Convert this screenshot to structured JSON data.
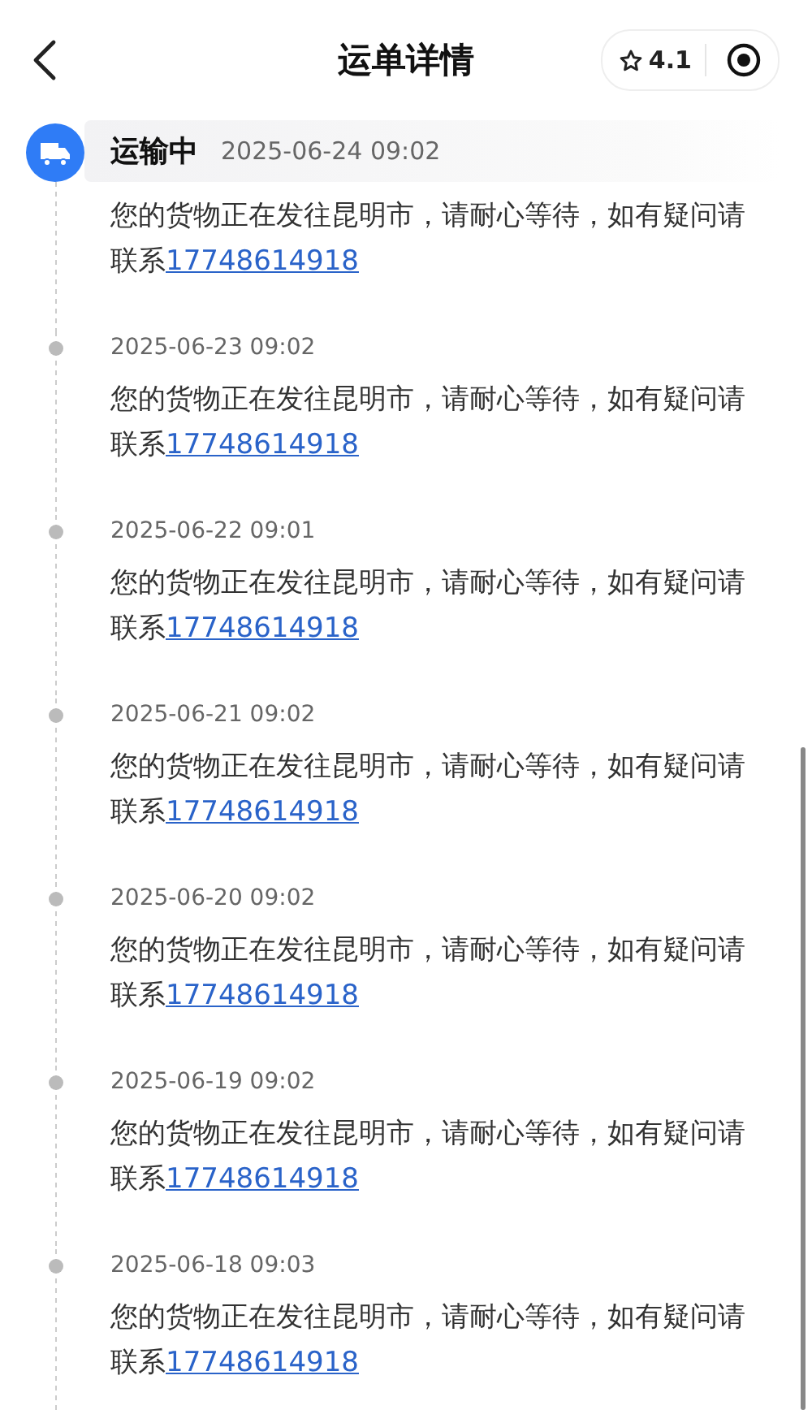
{
  "header": {
    "title": "运单详情",
    "rating": "4.1"
  },
  "status": {
    "label": "运输中",
    "time": "2025-06-24 09:02",
    "message": "您的货物正在发往昆明市，请耐心等待，如有疑问请联系",
    "phone": "17748614918"
  },
  "entries": [
    {
      "time": "2025-06-23 09:02",
      "message": "您的货物正在发往昆明市，请耐心等待，如有疑问请联系",
      "phone": "17748614918"
    },
    {
      "time": "2025-06-22 09:01",
      "message": "您的货物正在发往昆明市，请耐心等待，如有疑问请联系",
      "phone": "17748614918"
    },
    {
      "time": "2025-06-21 09:02",
      "message": "您的货物正在发往昆明市，请耐心等待，如有疑问请联系",
      "phone": "17748614918"
    },
    {
      "time": "2025-06-20 09:02",
      "message": "您的货物正在发往昆明市，请耐心等待，如有疑问请联系",
      "phone": "17748614918"
    },
    {
      "time": "2025-06-19 09:02",
      "message": "您的货物正在发往昆明市，请耐心等待，如有疑问请联系",
      "phone": "17748614918"
    },
    {
      "time": "2025-06-18 09:03",
      "message": "您的货物正在发往昆明市，请耐心等待，如有疑问请联系",
      "phone": "17748614918"
    }
  ]
}
